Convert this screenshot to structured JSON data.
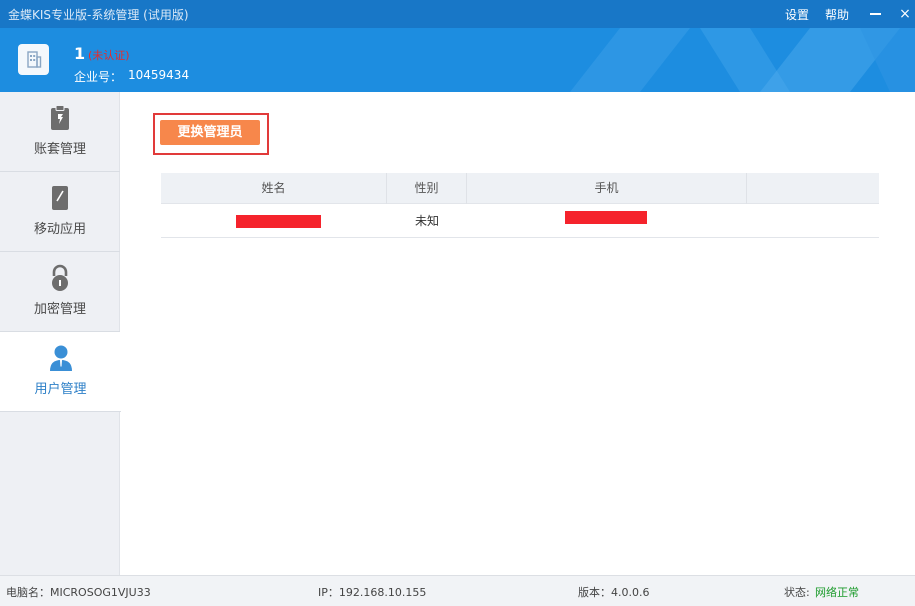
{
  "window": {
    "title": "金蝶KIS专业版-系统管理 (试用版)",
    "settings_label": "设置",
    "help_label": "帮助",
    "close_glyph": "×"
  },
  "header": {
    "company_id": "1",
    "company_status": "(未认证)",
    "company_no_label": "企业号：",
    "company_no": "10459434"
  },
  "sidebar": {
    "items": [
      {
        "label": "账套管理",
        "icon": "clipboard-wrench-icon"
      },
      {
        "label": "移动应用",
        "icon": "mobile-phone-icon"
      },
      {
        "label": "加密管理",
        "icon": "padlock-icon"
      },
      {
        "label": "用户管理",
        "icon": "user-icon"
      }
    ],
    "active_index": 3
  },
  "main": {
    "change_admin_label": "更换管理员",
    "table": {
      "columns": [
        "姓名",
        "性别",
        "手机",
        ""
      ],
      "rows": [
        {
          "name": "",
          "gender": "未知",
          "phone": ""
        }
      ]
    }
  },
  "status": {
    "computer_label": "电脑名：MICROSOG1VJU33",
    "ip_label": "IP：192.168.10.155",
    "version_label": "版本：4.0.0.6",
    "state_label": "状态:",
    "state_value": "网络正常"
  },
  "colors": {
    "titlebar": "#1877c7",
    "banner": "#1d8de0",
    "accent_button": "#f7874b",
    "highlight_border": "#e13a3a",
    "status_ok": "#1a9a2a"
  }
}
